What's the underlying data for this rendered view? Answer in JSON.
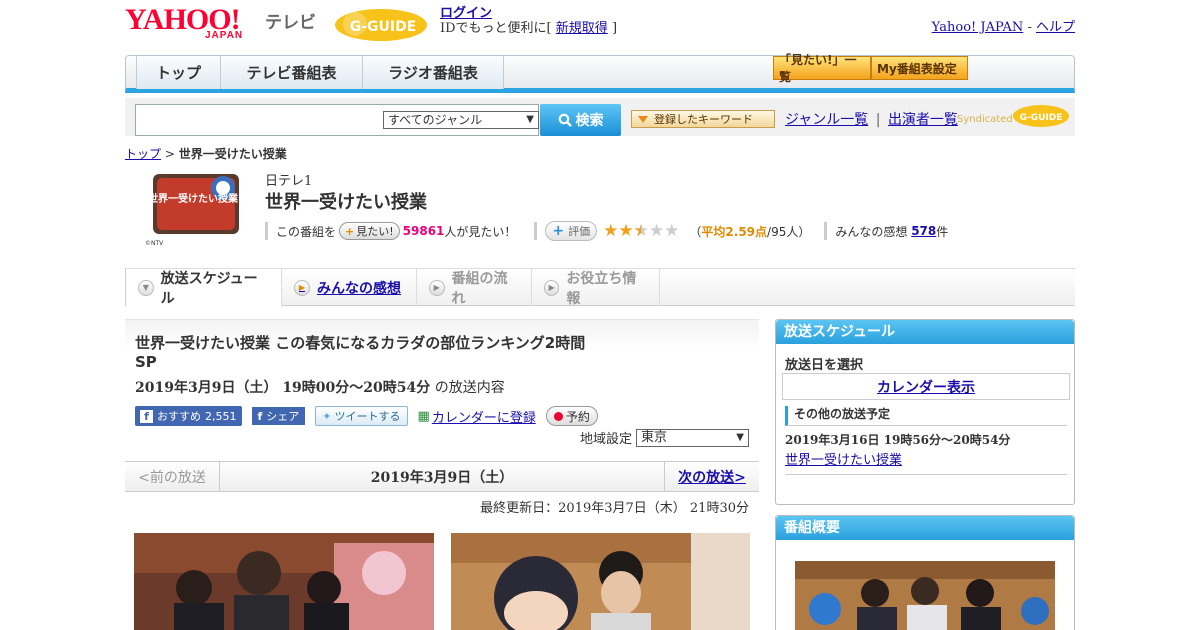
{
  "header": {
    "logo_text": "YAHOO!",
    "logo_sub": "JAPAN",
    "tv_label": "テレビ",
    "gguide": "G-GUIDE",
    "login_label": "ログイン",
    "login_note_prefix": "IDでもっと便利に[",
    "signup_label": "新規取得",
    "login_note_suffix": "]",
    "yahoo_japan_link": "Yahoo! JAPAN",
    "separator": "-",
    "help_link": "ヘルプ"
  },
  "nav": {
    "tabs": [
      {
        "label": "トップ"
      },
      {
        "label": "テレビ番組表"
      },
      {
        "label": "ラジオ番組表"
      }
    ],
    "mitai_list": "「見たい!」一覧",
    "my_schedule": "My番組表設定"
  },
  "search": {
    "query": "",
    "genre": "すべてのジャンル",
    "button_label": "検索",
    "keyword_button": "登録したキーワード",
    "genre_list_link": "ジャンル一覧",
    "sep": "|",
    "cast_list_link": "出演者一覧",
    "syndicated": "Syndicated",
    "syndicated_logo": "G-GUIDE"
  },
  "breadcrumb": {
    "home": "トップ",
    "separator": ">",
    "current": "世界一受けたい授業"
  },
  "program": {
    "thumb_text": "世界一受けたい授業",
    "thumb_credit": "©NTV",
    "channel": "日テレ1",
    "title": "世界一受けたい授業",
    "watch_prefix": "この番組を",
    "watch_button": "見たい!",
    "watch_count": "59861",
    "watch_suffix": "人が見たい！",
    "rate_button": "評価",
    "rating_value": 2.59,
    "rating_open": "（",
    "rating_avg": "平均2.59点",
    "rating_people": "/95人）",
    "impressions_prefix": "みんなの感想",
    "impressions_count": "578",
    "impressions_suffix": "件"
  },
  "content_tabs": [
    {
      "label": "放送スケジュール",
      "state": "active"
    },
    {
      "label": "みんなの感想",
      "state": "link"
    },
    {
      "label": "番組の流れ",
      "state": "disabled"
    },
    {
      "label": "お役立ち情報",
      "state": "disabled"
    }
  ],
  "episode": {
    "title": "世界一受けたい授業 この春気になるカラダの部位ランキング2時間SP",
    "date": "2019年3月9日（土） 19時00分～20時54分",
    "date_suffix": "の放送内容",
    "fb_recommend": "おすすめ",
    "fb_count": "2,551",
    "fb_share": "シェア",
    "tweet": "ツイートする",
    "calendar": "カレンダーに登録",
    "reserve": "予約",
    "region_label": "地域設定",
    "region_value": "東京"
  },
  "pager": {
    "prev": "<前の放送",
    "current": "2019年3月9日（土）",
    "next": "次の放送>"
  },
  "updated": "最終更新日：2019年3月7日（木） 21時30分",
  "sidebar": {
    "schedule_title": "放送スケジュール",
    "select_date": "放送日を選択",
    "calendar_link": "カレンダー表示",
    "other_label": "その他の放送予定",
    "other_date": "2019年3月16日 19時56分～20時54分",
    "other_name": "世界一受けたい授業",
    "summary_title": "番組概要"
  },
  "colors": {
    "accent": "#2aa3e0",
    "brand_red": "#ff0033",
    "star": "#f0a019",
    "pink": "#e8007c"
  }
}
